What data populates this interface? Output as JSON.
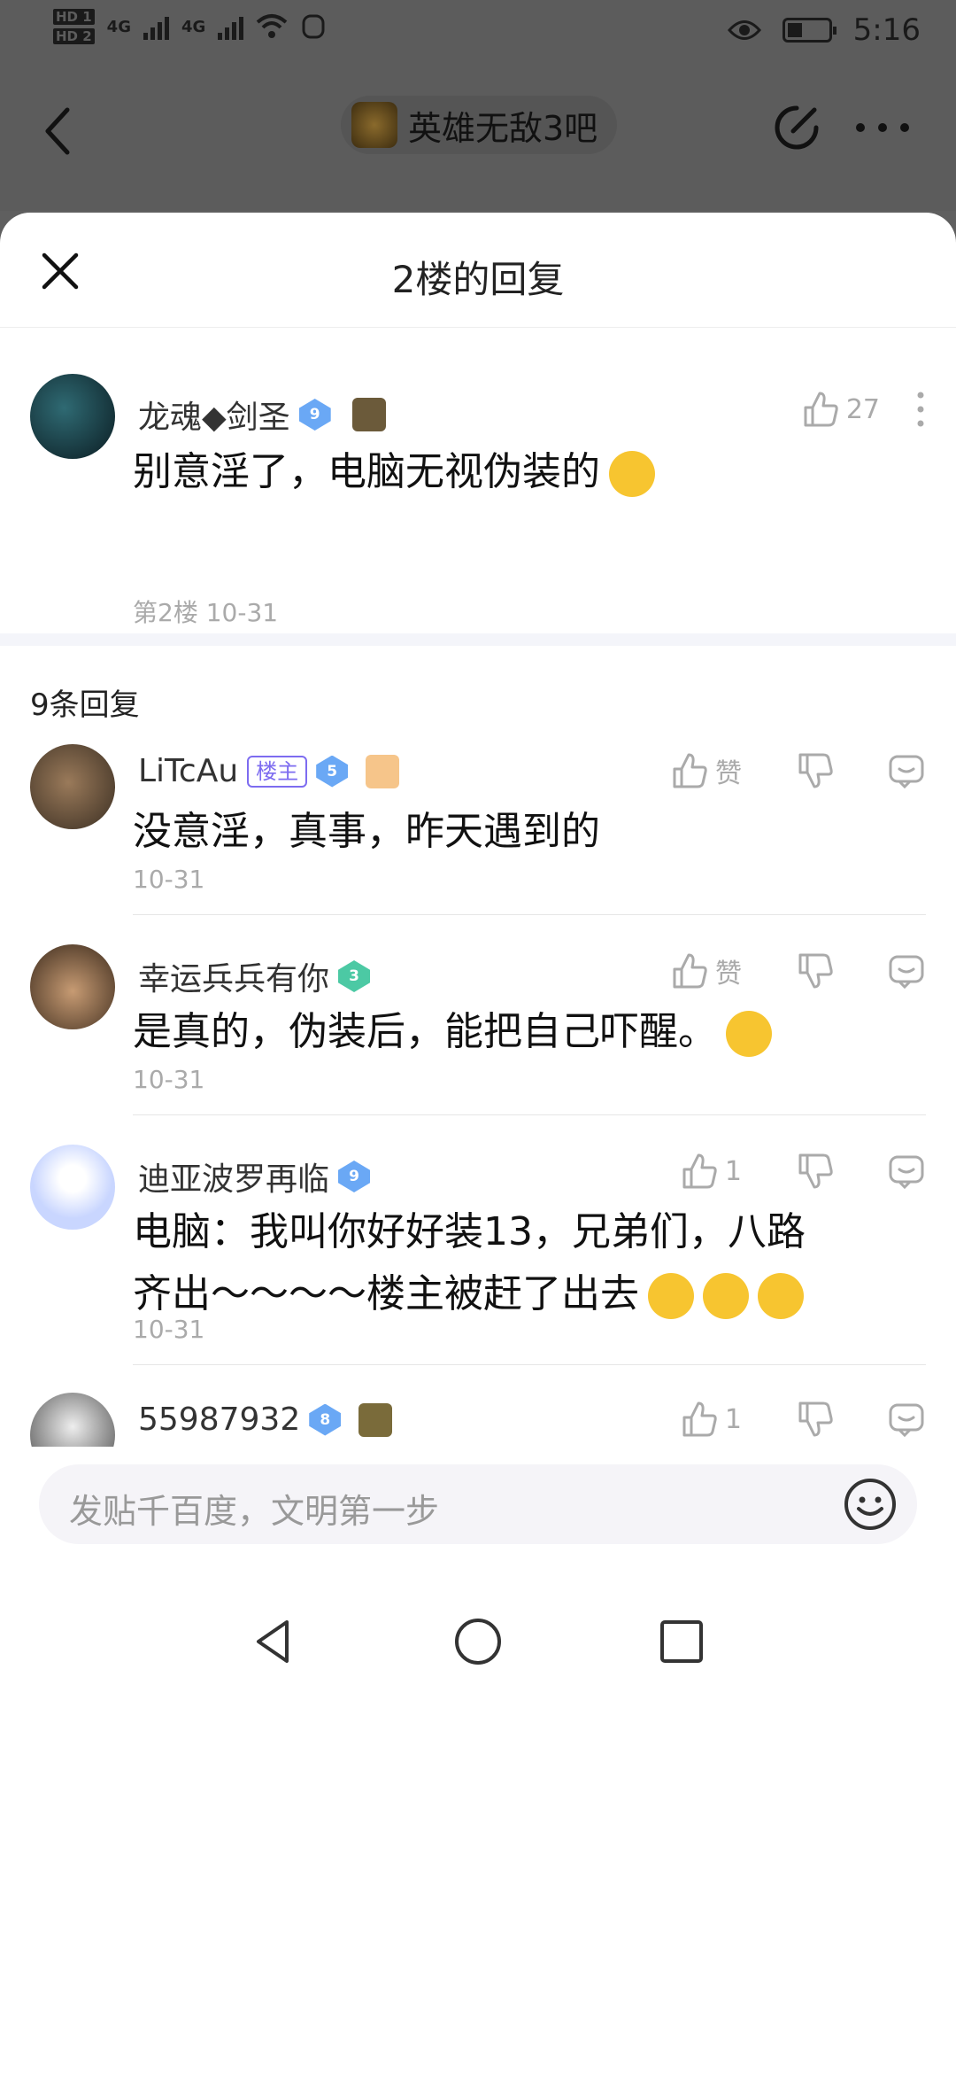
{
  "status_bar": {
    "hd1": "HD 1",
    "hd2": "HD 2",
    "network1": "4G",
    "network2": "4G",
    "time": "5:16"
  },
  "top_nav": {
    "forum_name": "英雄无敌3吧"
  },
  "sheet": {
    "title": "2楼的回复"
  },
  "main_post": {
    "user": "龙魂◆剑圣",
    "level": "9",
    "likes": "27",
    "content": "别意淫了，电脑无视伪装的",
    "meta": "第2楼  10-31"
  },
  "reply_count": "9条回复",
  "replies": [
    {
      "user": "LiTcAu",
      "tag": "楼主",
      "level": "5",
      "like_label": "赞",
      "content": "没意淫，真事，昨天遇到的",
      "date": "10-31"
    },
    {
      "user": "幸运兵兵有你",
      "level": "3",
      "like_label": "赞",
      "content": "是真的，伪装后，能把自己吓醒。",
      "date": "10-31"
    },
    {
      "user": "迪亚波罗再临",
      "level": "9",
      "like_label": "1",
      "content_line1": "电脑：我叫你好好装13，兄弟们，八路",
      "content_line2": "齐出～～～～楼主被赶了出去",
      "date": "10-31"
    },
    {
      "user": "55987932",
      "level": "8",
      "like_label": "1"
    }
  ],
  "composer": {
    "placeholder": "发贴千百度，文明第一步"
  },
  "colors": {
    "accent": "#7d6cf0",
    "level_blue": "#6aa8f5",
    "level_green": "#4cc9a4",
    "meta_gray": "#aaaaaa"
  }
}
